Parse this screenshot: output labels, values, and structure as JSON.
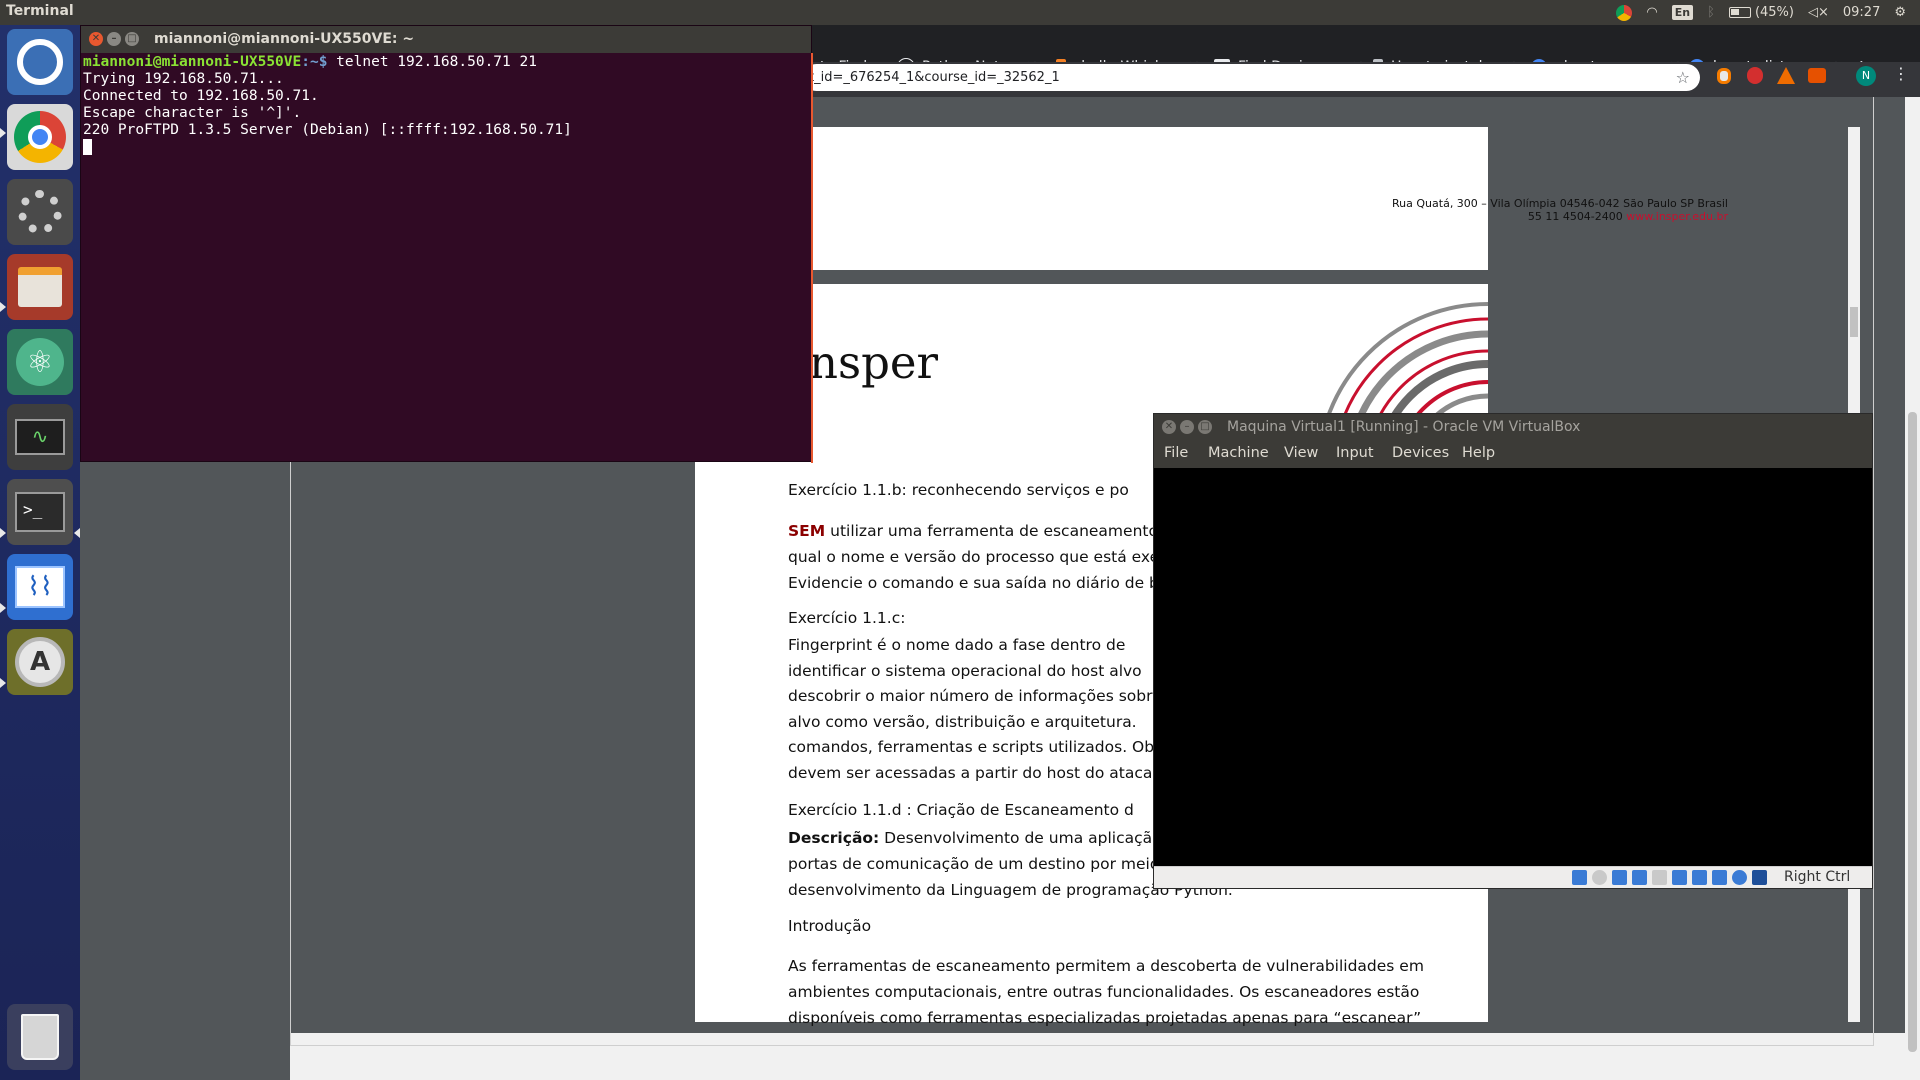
{
  "top_panel": {
    "app_name": "Terminal",
    "keyboard_layout": "En",
    "battery": "(45%)",
    "clock": "09:27"
  },
  "launcher": {
    "items": [
      "ubuntu-logo",
      "chrome",
      "system-settings",
      "file-manager",
      "atom",
      "system-monitor",
      "terminal",
      "system-monitor-graph",
      "software-updater",
      "trash"
    ]
  },
  "browser": {
    "tabs": [
      {
        "label": "to Find"
      },
      {
        "label": "Python Netwo"
      },
      {
        "label": "shell - Which"
      },
      {
        "label": "Find Devices"
      },
      {
        "label": "How to instal"
      },
      {
        "label": "ubuntu proce"
      },
      {
        "label": "how to listen"
      }
    ],
    "address": "t_id=_676254_1&course_id=_32562_1",
    "profile_initial": "N"
  },
  "pdf": {
    "footer_address": "Rua Quatá, 300 – Vila Olímpia 04546-042 São Paulo SP Brasil",
    "footer_phone": "55 11 4504-2400",
    "footer_site": "www.insper.edu.br",
    "logo_text": "nsper",
    "ex_1b_title": "Exercício 1.1.b: reconhecendo serviços e po",
    "ex_1b_sem": "SEM",
    "ex_1b_line1": " utilizar uma ferramenta de escaneamento d",
    "ex_1b_line2": "qual o nome e versão do processo que está execu",
    "ex_1b_line3": "Evidencie o comando e sua saída no diário de bor",
    "ex_1c_title": "Exercício 1.1.c:",
    "ex_1c_line1": "Fingerprint é o nome dado a fase dentro de",
    "ex_1c_line2": "identificar o sistema operacional do host alvo",
    "ex_1c_line3": "descobrir o maior número de informações sobre",
    "ex_1c_line4": "alvo como versão, distribuição e arquitetura.",
    "ex_1c_line5": "comandos, ferramentas e scripts utilizados. Obr",
    "ex_1c_line6": "devem ser acessadas a partir do host do atacante",
    "ex_1d_title": "Exercício 1.1.d :  Criação de Escaneamento d",
    "desc_label": "Descrição:",
    "desc_line1": " Desenvolvimento de uma aplicação d",
    "desc_line2": "portas de comunicação de um destino por meio d",
    "desc_line3": "desenvolvimento da Linguagem de programação Python.",
    "intro_title": "Introdução",
    "intro_line1": "As ferramentas de escaneamento permitem a descoberta de vulnerabilidades em",
    "intro_line2": "ambientes computacionais, entre outras funcionalidades. Os escaneadores estão",
    "intro_line3": "disponíveis como ferramentas especializadas projetadas apenas para “escanear”"
  },
  "terminal": {
    "title": "miannoni@miannoni-UX550VE: ~",
    "prompt_user": "miannoni@miannoni-UX550VE",
    "prompt_path": ":~$ ",
    "command": "telnet 192.168.50.71 21",
    "output": [
      "Trying 192.168.50.71...",
      "Connected to 192.168.50.71.",
      "Escape character is '^]'.",
      "220 ProFTPD 1.3.5 Server (Debian) [::ffff:192.168.50.71]"
    ]
  },
  "vbox": {
    "title": "Maquina Virtual1 [Running] - Oracle VM VirtualBox",
    "menu": [
      "File",
      "Machine",
      "View",
      "Input",
      "Devices",
      "Help"
    ],
    "host_key": "Right Ctrl"
  },
  "colors": {
    "terminal_bg": "#300a24",
    "prompt_green": "#8ae234",
    "prompt_blue": "#729fcf",
    "insper_red": "#c8102e"
  }
}
